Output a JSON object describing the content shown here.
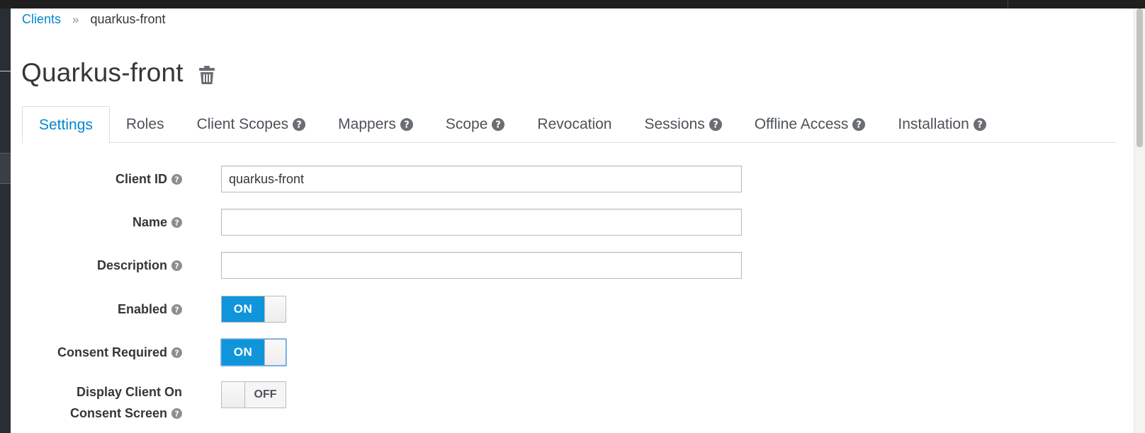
{
  "breadcrumb": {
    "parent": "Clients",
    "separator": "»",
    "current": "quarkus-front"
  },
  "page": {
    "title": "Quarkus-front"
  },
  "tabs": [
    {
      "label": "Settings",
      "active": true,
      "help": false
    },
    {
      "label": "Roles",
      "active": false,
      "help": false
    },
    {
      "label": "Client Scopes",
      "active": false,
      "help": true
    },
    {
      "label": "Mappers",
      "active": false,
      "help": true
    },
    {
      "label": "Scope",
      "active": false,
      "help": true
    },
    {
      "label": "Revocation",
      "active": false,
      "help": false
    },
    {
      "label": "Sessions",
      "active": false,
      "help": true
    },
    {
      "label": "Offline Access",
      "active": false,
      "help": true
    },
    {
      "label": "Installation",
      "active": false,
      "help": true
    }
  ],
  "form": {
    "client_id": {
      "label": "Client ID",
      "value": "quarkus-front"
    },
    "name": {
      "label": "Name",
      "value": ""
    },
    "description": {
      "label": "Description",
      "value": ""
    },
    "enabled": {
      "label": "Enabled",
      "state": "ON"
    },
    "consent_required": {
      "label": "Consent Required",
      "state": "ON"
    },
    "display_client": {
      "label_line1": "Display Client On",
      "label_line2": "Consent Screen",
      "state": "OFF"
    }
  },
  "colors": {
    "accent": "#0088ce",
    "toggle_on": "#0e95da",
    "nav_bg": "#292e34",
    "topbar_bg": "#1f1f1f"
  },
  "icons": {
    "help": "question-circle-icon",
    "delete": "trash-icon"
  }
}
